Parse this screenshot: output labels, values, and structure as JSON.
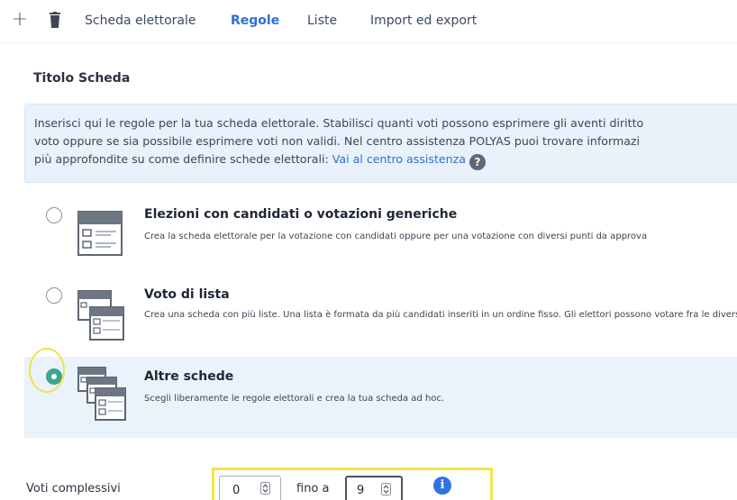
{
  "toolbar": {
    "add_icon": "plus-icon",
    "delete_icon": "trash-icon",
    "tabs": [
      {
        "label": "Scheda elettorale",
        "active": false
      },
      {
        "label": "Regole",
        "active": true
      },
      {
        "label": "Liste",
        "active": false
      },
      {
        "label": "Import ed export",
        "active": false
      }
    ]
  },
  "page": {
    "title": "Titolo Scheda"
  },
  "info": {
    "line1": "Inserisci qui le regole per la tua scheda elettorale. Stabilisci quanti voti possono esprimere gli aventi diritto",
    "line2": "voto oppure se sia possibile esprimere voti non validi. Nel centro assistenza POLYAS puoi trovare informazi",
    "line3": "più approfondite su come definire schede elettorali: ",
    "link": "Vai al centro assistenza",
    "help_icon": "?"
  },
  "options": [
    {
      "title": "Elezioni con candidati o votazioni generiche",
      "description": "Crea la scheda elettorale per la votazione con candidati oppure per una votazione con diversi punti da approva",
      "selected": false,
      "icon": "single-ballot-icon"
    },
    {
      "title": "Voto di lista",
      "description": "Crea una scheda con più liste. Una lista è formata da più candidati inseriti in un ordine fisso. Gli elettori possono votare fra le diverse liste.",
      "selected": false,
      "icon": "list-ballot-icon"
    },
    {
      "title": "Altre schede",
      "description": "Scegli liberamente le regole elettorali e crea la tua scheda ad hoc.",
      "selected": true,
      "icon": "multi-ballot-icon"
    }
  ],
  "votes": {
    "label": "Voti complessivi",
    "from_value": "0",
    "range_label": "fino a",
    "to_value": "9",
    "info_icon": "i"
  },
  "colors": {
    "accent": "#2d6fd6",
    "info_bg": "#e9f2fb",
    "selected_radio": "#3aa68f",
    "annotation_highlight": "#efe44a"
  }
}
